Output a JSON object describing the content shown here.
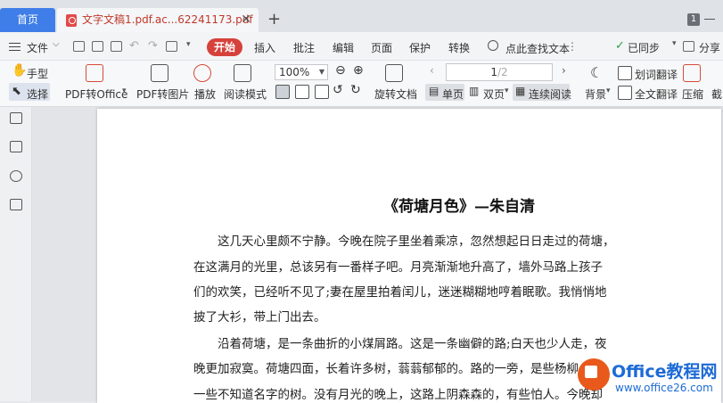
{
  "tabs": {
    "home": "首页",
    "document": "文字文稿1.pdf.ac...62241173.pdf",
    "close": "✕",
    "new": "+",
    "window_count": "1"
  },
  "menu": {
    "file": "文件",
    "items": [
      "开始",
      "插入",
      "批注",
      "编辑",
      "页面",
      "保护",
      "转换"
    ],
    "search": "点此查找文本",
    "sync": "已同步",
    "share": "分享"
  },
  "ribbon": {
    "hand": "手型",
    "select": "选择",
    "pdf_to_office": "PDF转Office",
    "pdf_to_image": "PDF转图片",
    "play": "播放",
    "read_mode": "阅读模式",
    "zoom": "100%",
    "rotate": "旋转文档",
    "page_current": "1",
    "page_total": "/2",
    "single": "单页",
    "double": "双页",
    "continuous": "连续阅读",
    "background": "背景",
    "word_translate": "划词翻译",
    "full_translate": "全文翻译",
    "compress": "压缩",
    "cut": "截"
  },
  "document": {
    "title": "《荷塘月色》—朱自清",
    "lines": [
      "　　这几天心里颇不宁静。今晚在院子里坐着乘凉，忽然想起日日走过的荷塘，",
      "在这满月的光里，总该另有一番样子吧。月亮渐渐地升高了，墙外马路上孩子",
      "们的欢笑，已经听不见了;妻在屋里拍着闰儿，迷迷糊糊地哼着眠歌。我悄悄地",
      "披了大衫，带上门出去。",
      "　　沿着荷塘，是一条曲折的小煤屑路。这是一条幽僻的路;白天也少人走，夜",
      "晚更加寂寞。荷塘四面，长着许多树，蓊蓊郁郁的。路的一旁，是些杨柳，和",
      "一些不知道名字的树。没有月光的晚上，这路上阴森森的，有些怕人。今晚却"
    ]
  },
  "watermark": {
    "brand": "Office教程网",
    "url": "www.office26.com"
  }
}
